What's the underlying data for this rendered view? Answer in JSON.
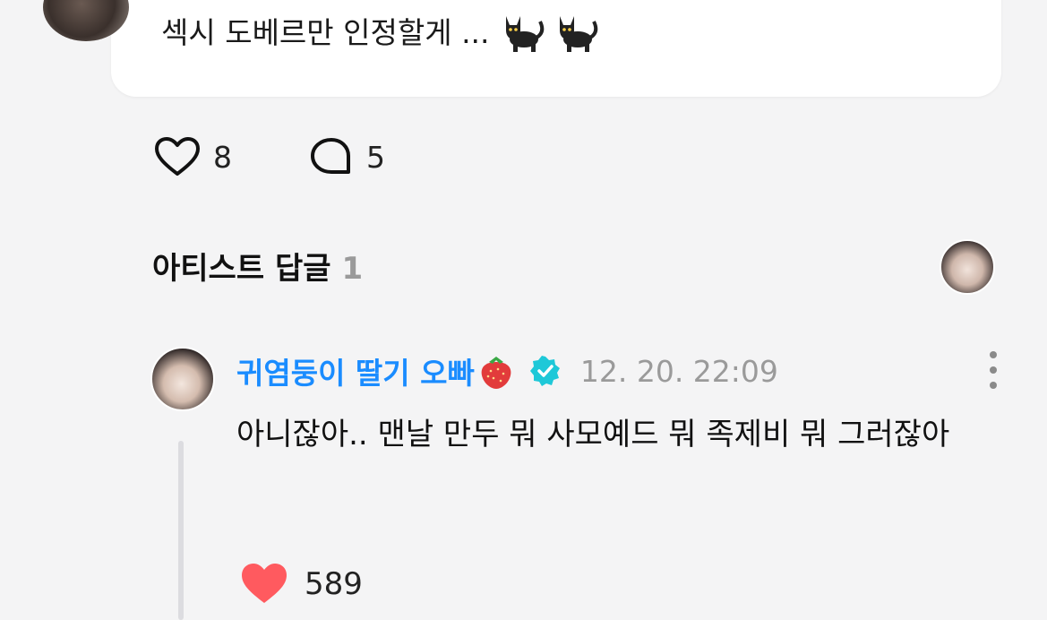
{
  "post": {
    "text": "섹시 도베르만 인정할게 ...",
    "emoji": [
      "cat-emoji",
      "cat-emoji"
    ],
    "likes": "8",
    "comments": "5"
  },
  "section": {
    "title": "아티스트 답글",
    "count": "1"
  },
  "reply": {
    "author": "귀염둥이 딸기 오빠",
    "author_emoji": "strawberry-emoji",
    "verified": true,
    "timestamp": "12. 20. 22:09",
    "text": "아니잖아.. 맨날 만두 뭐 사모예드 뭐 족제비 뭐 그러잖아",
    "likes": "589",
    "liked": true
  },
  "colors": {
    "author": "#1a8cff",
    "verified_badge": "#1ec8d8",
    "heart_filled": "#ff5a5f",
    "timestamp": "#9a9a9a",
    "background": "#f4f4f5"
  }
}
